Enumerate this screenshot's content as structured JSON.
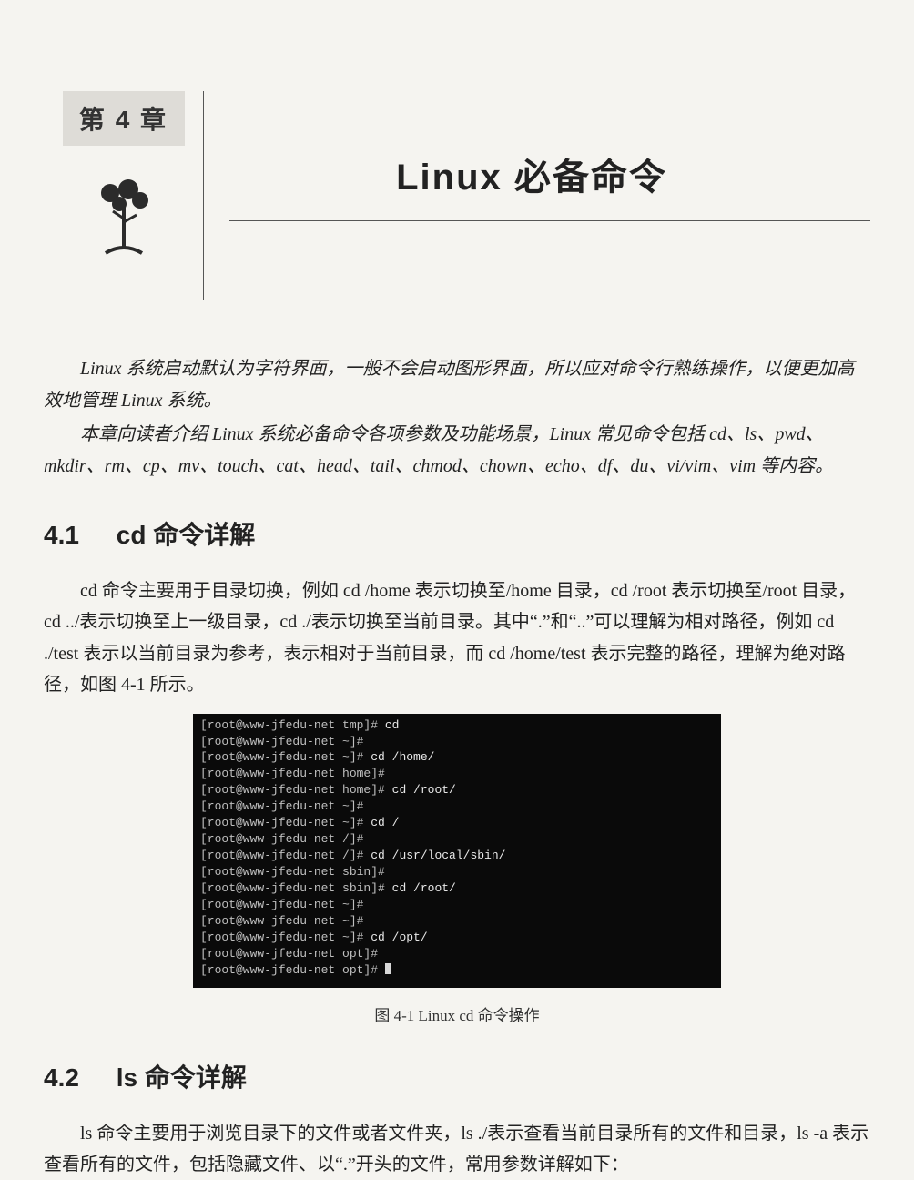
{
  "chapter_label": "第 4 章",
  "chapter_title": "Linux 必备命令",
  "intro_p1": "Linux 系统启动默认为字符界面，一般不会启动图形界面，所以应对命令行熟练操作，以便更加高效地管理 Linux 系统。",
  "intro_p2": "本章向读者介绍 Linux 系统必备命令各项参数及功能场景，Linux 常见命令包括 cd、ls、pwd、mkdir、rm、cp、mv、touch、cat、head、tail、chmod、chown、echo、df、du、vi/vim、vim 等内容。",
  "section41_num": "4.1",
  "section41_title": "cd 命令详解",
  "section41_body": "cd 命令主要用于目录切换，例如 cd /home 表示切换至/home 目录，cd /root 表示切换至/root 目录，cd ../表示切换至上一级目录，cd ./表示切换至当前目录。其中“.”和“..”可以理解为相对路径，例如 cd ./test 表示以当前目录为参考，表示相对于当前目录，而 cd /home/test 表示完整的路径，理解为绝对路径，如图 4-1 所示。",
  "terminal_lines": [
    {
      "prompt": "[root@www-jfedu-net tmp]# ",
      "cmd": "cd"
    },
    {
      "prompt": "[root@www-jfedu-net ~]# ",
      "cmd": ""
    },
    {
      "prompt": "[root@www-jfedu-net ~]# ",
      "cmd": "cd /home/"
    },
    {
      "prompt": "[root@www-jfedu-net home]# ",
      "cmd": ""
    },
    {
      "prompt": "[root@www-jfedu-net home]# ",
      "cmd": "cd /root/"
    },
    {
      "prompt": "[root@www-jfedu-net ~]# ",
      "cmd": ""
    },
    {
      "prompt": "[root@www-jfedu-net ~]# ",
      "cmd": "cd /"
    },
    {
      "prompt": "[root@www-jfedu-net /]# ",
      "cmd": ""
    },
    {
      "prompt": "[root@www-jfedu-net /]# ",
      "cmd": "cd /usr/local/sbin/"
    },
    {
      "prompt": "[root@www-jfedu-net sbin]# ",
      "cmd": ""
    },
    {
      "prompt": "[root@www-jfedu-net sbin]# ",
      "cmd": "cd /root/"
    },
    {
      "prompt": "[root@www-jfedu-net ~]# ",
      "cmd": ""
    },
    {
      "prompt": "[root@www-jfedu-net ~]# ",
      "cmd": ""
    },
    {
      "prompt": "[root@www-jfedu-net ~]# ",
      "cmd": "cd /opt/"
    },
    {
      "prompt": "[root@www-jfedu-net opt]# ",
      "cmd": ""
    },
    {
      "prompt": "[root@www-jfedu-net opt]# ",
      "cmd": ""
    }
  ],
  "fig_caption": "图 4-1   Linux cd 命令操作",
  "section42_num": "4.2",
  "section42_title": "ls 命令详解",
  "section42_body": "ls 命令主要用于浏览目录下的文件或者文件夹，ls ./表示查看当前目录所有的文件和目录，ls -a 表示查看所有的文件，包括隐藏文件、以“.”开头的文件，常用参数详解如下："
}
